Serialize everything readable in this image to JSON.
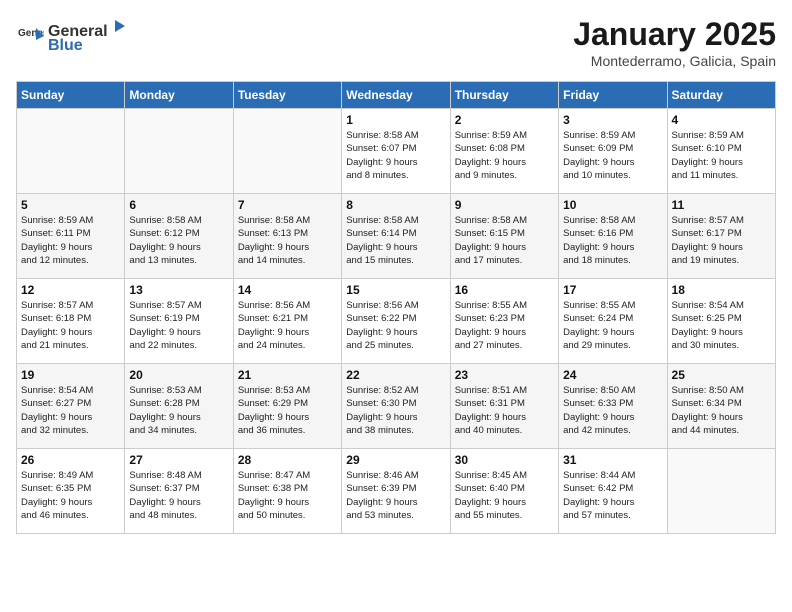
{
  "logo": {
    "text_general": "General",
    "text_blue": "Blue"
  },
  "title": "January 2025",
  "subtitle": "Montederramo, Galicia, Spain",
  "days_of_week": [
    "Sunday",
    "Monday",
    "Tuesday",
    "Wednesday",
    "Thursday",
    "Friday",
    "Saturday"
  ],
  "weeks": [
    [
      {
        "day": "",
        "info": ""
      },
      {
        "day": "",
        "info": ""
      },
      {
        "day": "",
        "info": ""
      },
      {
        "day": "1",
        "info": "Sunrise: 8:58 AM\nSunset: 6:07 PM\nDaylight: 9 hours\nand 8 minutes."
      },
      {
        "day": "2",
        "info": "Sunrise: 8:59 AM\nSunset: 6:08 PM\nDaylight: 9 hours\nand 9 minutes."
      },
      {
        "day": "3",
        "info": "Sunrise: 8:59 AM\nSunset: 6:09 PM\nDaylight: 9 hours\nand 10 minutes."
      },
      {
        "day": "4",
        "info": "Sunrise: 8:59 AM\nSunset: 6:10 PM\nDaylight: 9 hours\nand 11 minutes."
      }
    ],
    [
      {
        "day": "5",
        "info": "Sunrise: 8:59 AM\nSunset: 6:11 PM\nDaylight: 9 hours\nand 12 minutes."
      },
      {
        "day": "6",
        "info": "Sunrise: 8:58 AM\nSunset: 6:12 PM\nDaylight: 9 hours\nand 13 minutes."
      },
      {
        "day": "7",
        "info": "Sunrise: 8:58 AM\nSunset: 6:13 PM\nDaylight: 9 hours\nand 14 minutes."
      },
      {
        "day": "8",
        "info": "Sunrise: 8:58 AM\nSunset: 6:14 PM\nDaylight: 9 hours\nand 15 minutes."
      },
      {
        "day": "9",
        "info": "Sunrise: 8:58 AM\nSunset: 6:15 PM\nDaylight: 9 hours\nand 17 minutes."
      },
      {
        "day": "10",
        "info": "Sunrise: 8:58 AM\nSunset: 6:16 PM\nDaylight: 9 hours\nand 18 minutes."
      },
      {
        "day": "11",
        "info": "Sunrise: 8:57 AM\nSunset: 6:17 PM\nDaylight: 9 hours\nand 19 minutes."
      }
    ],
    [
      {
        "day": "12",
        "info": "Sunrise: 8:57 AM\nSunset: 6:18 PM\nDaylight: 9 hours\nand 21 minutes."
      },
      {
        "day": "13",
        "info": "Sunrise: 8:57 AM\nSunset: 6:19 PM\nDaylight: 9 hours\nand 22 minutes."
      },
      {
        "day": "14",
        "info": "Sunrise: 8:56 AM\nSunset: 6:21 PM\nDaylight: 9 hours\nand 24 minutes."
      },
      {
        "day": "15",
        "info": "Sunrise: 8:56 AM\nSunset: 6:22 PM\nDaylight: 9 hours\nand 25 minutes."
      },
      {
        "day": "16",
        "info": "Sunrise: 8:55 AM\nSunset: 6:23 PM\nDaylight: 9 hours\nand 27 minutes."
      },
      {
        "day": "17",
        "info": "Sunrise: 8:55 AM\nSunset: 6:24 PM\nDaylight: 9 hours\nand 29 minutes."
      },
      {
        "day": "18",
        "info": "Sunrise: 8:54 AM\nSunset: 6:25 PM\nDaylight: 9 hours\nand 30 minutes."
      }
    ],
    [
      {
        "day": "19",
        "info": "Sunrise: 8:54 AM\nSunset: 6:27 PM\nDaylight: 9 hours\nand 32 minutes."
      },
      {
        "day": "20",
        "info": "Sunrise: 8:53 AM\nSunset: 6:28 PM\nDaylight: 9 hours\nand 34 minutes."
      },
      {
        "day": "21",
        "info": "Sunrise: 8:53 AM\nSunset: 6:29 PM\nDaylight: 9 hours\nand 36 minutes."
      },
      {
        "day": "22",
        "info": "Sunrise: 8:52 AM\nSunset: 6:30 PM\nDaylight: 9 hours\nand 38 minutes."
      },
      {
        "day": "23",
        "info": "Sunrise: 8:51 AM\nSunset: 6:31 PM\nDaylight: 9 hours\nand 40 minutes."
      },
      {
        "day": "24",
        "info": "Sunrise: 8:50 AM\nSunset: 6:33 PM\nDaylight: 9 hours\nand 42 minutes."
      },
      {
        "day": "25",
        "info": "Sunrise: 8:50 AM\nSunset: 6:34 PM\nDaylight: 9 hours\nand 44 minutes."
      }
    ],
    [
      {
        "day": "26",
        "info": "Sunrise: 8:49 AM\nSunset: 6:35 PM\nDaylight: 9 hours\nand 46 minutes."
      },
      {
        "day": "27",
        "info": "Sunrise: 8:48 AM\nSunset: 6:37 PM\nDaylight: 9 hours\nand 48 minutes."
      },
      {
        "day": "28",
        "info": "Sunrise: 8:47 AM\nSunset: 6:38 PM\nDaylight: 9 hours\nand 50 minutes."
      },
      {
        "day": "29",
        "info": "Sunrise: 8:46 AM\nSunset: 6:39 PM\nDaylight: 9 hours\nand 53 minutes."
      },
      {
        "day": "30",
        "info": "Sunrise: 8:45 AM\nSunset: 6:40 PM\nDaylight: 9 hours\nand 55 minutes."
      },
      {
        "day": "31",
        "info": "Sunrise: 8:44 AM\nSunset: 6:42 PM\nDaylight: 9 hours\nand 57 minutes."
      },
      {
        "day": "",
        "info": ""
      }
    ]
  ]
}
